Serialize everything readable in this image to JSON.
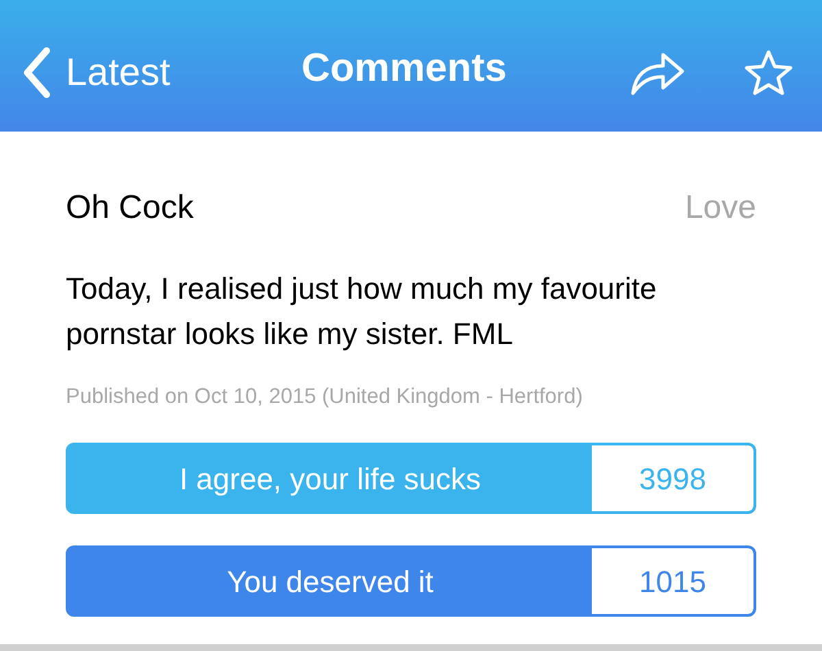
{
  "nav_bar": {
    "back_label": "Latest",
    "title": "Comments"
  },
  "post": {
    "title": "Oh Cock",
    "category": "Love",
    "body": "Today, I realised just how much my favourite pornstar looks like my sister. FML",
    "meta": "Published on Oct 10, 2015 (United Kingdom - Hertford)"
  },
  "votes": [
    {
      "label": "I agree, your life sucks",
      "count": "3998",
      "color": "#3bb4ee"
    },
    {
      "label": "You deserved it",
      "count": "1015",
      "color": "#3f86ea"
    }
  ]
}
